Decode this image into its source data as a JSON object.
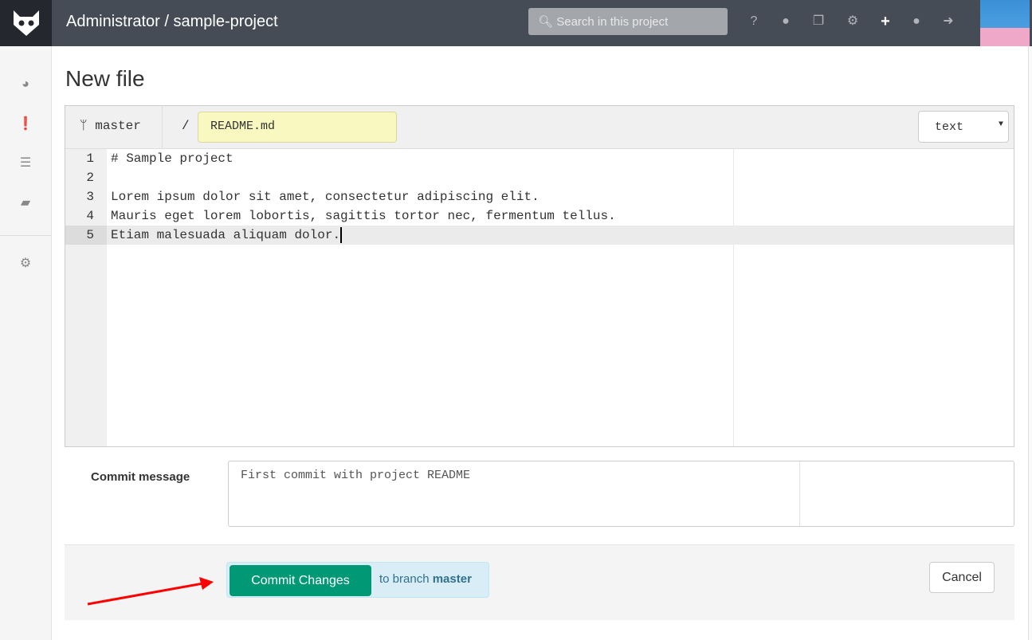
{
  "header": {
    "title": "Administrator / sample-project",
    "search_placeholder": "Search in this project",
    "icons": [
      "help-icon",
      "globe-icon",
      "snippets-icon",
      "admin-gears-icon",
      "plus-icon",
      "profile-icon",
      "sign-out-icon"
    ]
  },
  "sidebar": {
    "icons": [
      "dashboard-icon",
      "issues-icon",
      "projects-icon",
      "help-book-icon",
      "settings-icon"
    ]
  },
  "page": {
    "title": "New file"
  },
  "editor": {
    "branch": "master",
    "slash": "/",
    "filename": "README.md",
    "mode": "text",
    "lines": [
      {
        "n": "1",
        "text": "# Sample project"
      },
      {
        "n": "2",
        "text": ""
      },
      {
        "n": "3",
        "text": "Lorem ipsum dolor sit amet, consectetur adipiscing elit."
      },
      {
        "n": "4",
        "text": "Mauris eget lorem lobortis, sagittis tortor nec, fermentum tellus."
      },
      {
        "n": "5",
        "text": "Etiam malesuada aliquam dolor."
      }
    ],
    "active_line": 5
  },
  "commit": {
    "label": "Commit message",
    "message": "First commit with project README",
    "button": "Commit Changes",
    "to_branch_prefix": "to branch",
    "branch": "master",
    "cancel": "Cancel"
  },
  "colors": {
    "header": "#464c56",
    "commit_button": "#019875",
    "annotation_arrow": "#ff0000"
  }
}
